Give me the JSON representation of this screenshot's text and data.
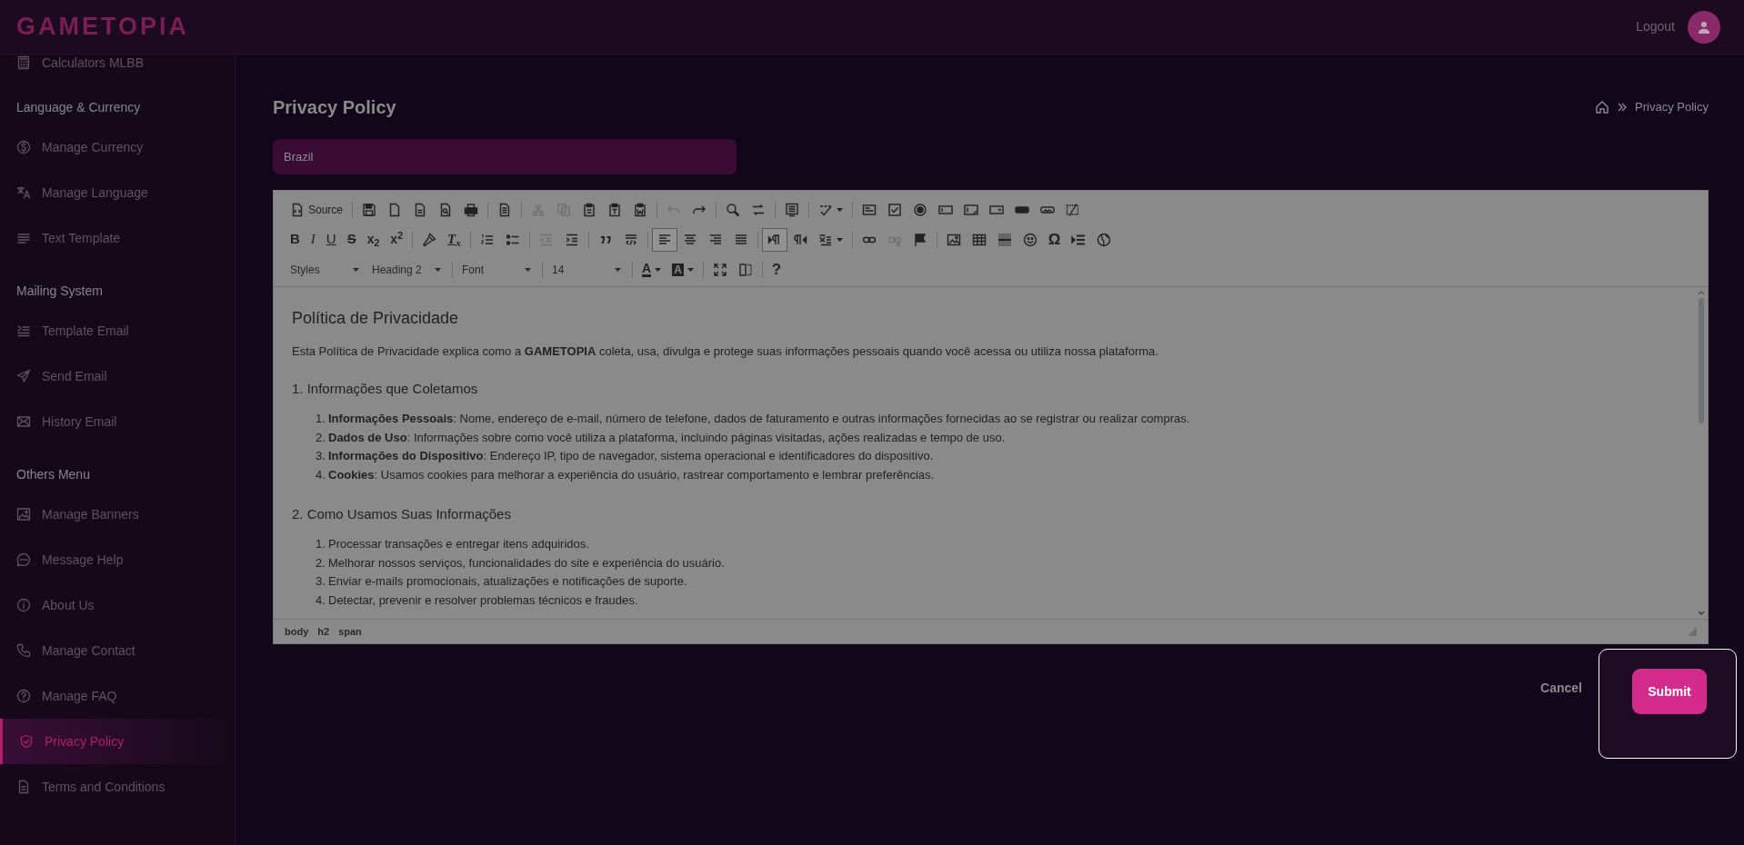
{
  "header": {
    "logo": "GAMETOPIA",
    "logout": "Logout"
  },
  "sidebar": {
    "top_item": {
      "label": "Calculators MLBB",
      "selected": false
    },
    "sections": [
      {
        "title": "Language & Currency",
        "items": [
          {
            "label": "Manage Currency",
            "selected": false
          },
          {
            "label": "Manage Language",
            "selected": false
          },
          {
            "label": "Text Template",
            "selected": false
          }
        ]
      },
      {
        "title": "Mailing System",
        "items": [
          {
            "label": "Template Email",
            "selected": false
          },
          {
            "label": "Send Email",
            "selected": false
          },
          {
            "label": "History Email",
            "selected": false
          }
        ]
      },
      {
        "title": "Others Menu",
        "items": [
          {
            "label": "Manage Banners",
            "selected": false
          },
          {
            "label": "Message Help",
            "selected": false
          },
          {
            "label": "About Us",
            "selected": false
          },
          {
            "label": "Manage Contact",
            "selected": false
          },
          {
            "label": "Manage FAQ",
            "selected": false
          },
          {
            "label": "Privacy Policy",
            "selected": true
          },
          {
            "label": "Terms and Conditions",
            "selected": false
          }
        ]
      }
    ]
  },
  "page": {
    "title": "Privacy Policy",
    "breadcrumb": "Privacy Policy",
    "country": "Brazil"
  },
  "toolbar": {
    "rows": [
      [
        [
          {
            "kind": "button",
            "label": "Source",
            "disabled": false,
            "on": false
          }
        ],
        [
          {
            "kind": "button",
            "disabled": false,
            "on": false
          },
          {
            "kind": "button",
            "disabled": false,
            "on": false
          },
          {
            "kind": "button",
            "disabled": false,
            "on": false
          },
          {
            "kind": "button",
            "disabled": false,
            "on": false
          },
          {
            "kind": "button",
            "disabled": false,
            "on": false
          }
        ],
        [
          {
            "kind": "button",
            "disabled": false,
            "on": false
          }
        ],
        [
          {
            "kind": "button",
            "disabled": true,
            "on": false
          },
          {
            "kind": "button",
            "disabled": true,
            "on": false
          },
          {
            "kind": "button",
            "disabled": false,
            "on": false
          },
          {
            "kind": "button",
            "disabled": false,
            "on": false
          },
          {
            "kind": "button",
            "disabled": false,
            "on": false
          }
        ],
        [
          {
            "kind": "button",
            "disabled": true,
            "on": false
          },
          {
            "kind": "button",
            "disabled": false,
            "on": false
          }
        ],
        [
          {
            "kind": "button",
            "disabled": false,
            "on": false
          },
          {
            "kind": "button",
            "disabled": false,
            "on": false
          }
        ],
        [
          {
            "kind": "button",
            "disabled": false,
            "on": false
          }
        ],
        [
          {
            "kind": "split",
            "disabled": false,
            "on": false
          }
        ],
        [
          {
            "kind": "button",
            "disabled": false,
            "on": false
          },
          {
            "kind": "button",
            "disabled": false,
            "on": false
          },
          {
            "kind": "button",
            "disabled": false,
            "on": false
          },
          {
            "kind": "button",
            "disabled": false,
            "on": false
          },
          {
            "kind": "button",
            "disabled": false,
            "on": false
          },
          {
            "kind": "button",
            "disabled": false,
            "on": false
          },
          {
            "kind": "button",
            "disabled": false,
            "on": false
          },
          {
            "kind": "button",
            "disabled": false,
            "on": false
          },
          {
            "kind": "button",
            "disabled": false,
            "on": false
          }
        ]
      ],
      [
        [
          {
            "kind": "button",
            "label": "B",
            "disabled": false,
            "on": false
          },
          {
            "kind": "button",
            "label": "I",
            "disabled": false,
            "on": false
          },
          {
            "kind": "button",
            "label": "U",
            "disabled": false,
            "on": false
          },
          {
            "kind": "button",
            "label": "S",
            "disabled": false,
            "on": false
          },
          {
            "kind": "button",
            "label": "x$_{2}$",
            "disabled": false,
            "on": false
          },
          {
            "kind": "button",
            "label": "x$^{2}$",
            "disabled": false,
            "on": false
          }
        ],
        [
          {
            "kind": "button",
            "disabled": false,
            "on": false
          },
          {
            "kind": "button",
            "label": "T$_{x}$",
            "disabled": false,
            "on": false
          }
        ],
        [
          {
            "kind": "button",
            "disabled": false,
            "on": false
          },
          {
            "kind": "button",
            "disabled": false,
            "on": false
          }
        ],
        [
          {
            "kind": "button",
            "disabled": true,
            "on": false
          },
          {
            "kind": "button",
            "disabled": false,
            "on": false
          }
        ],
        [
          {
            "kind": "button",
            "disabled": false,
            "on": false
          },
          {
            "kind": "button",
            "disabled": false,
            "on": false
          }
        ],
        [
          {
            "kind": "button",
            "disabled": false,
            "on": true
          },
          {
            "kind": "button",
            "disabled": false,
            "on": false
          },
          {
            "kind": "button",
            "disabled": false,
            "on": false
          },
          {
            "kind": "button",
            "disabled": false,
            "on": false
          }
        ],
        [
          {
            "kind": "button",
            "disabled": false,
            "on": true
          },
          {
            "kind": "button",
            "disabled": false,
            "on": false
          },
          {
            "kind": "split",
            "disabled": false,
            "on": false
          }
        ],
        [
          {
            "kind": "button",
            "disabled": false,
            "on": false
          },
          {
            "kind": "button",
            "disabled": true,
            "on": false
          },
          {
            "kind": "button",
            "disabled": false,
            "on": false
          }
        ],
        [
          {
            "kind": "button",
            "disabled": false,
            "on": false
          },
          {
            "kind": "button",
            "disabled": false,
            "on": false
          },
          {
            "kind": "button",
            "disabled": false,
            "on": false
          },
          {
            "kind": "button",
            "disabled": false,
            "on": false
          },
          {
            "kind": "button",
            "label": "Ω",
            "disabled": false,
            "on": false
          },
          {
            "kind": "button",
            "disabled": false,
            "on": false
          },
          {
            "kind": "button",
            "disabled": false,
            "on": false
          }
        ]
      ],
      [
        [
          {
            "kind": "combo",
            "label": "Styles"
          },
          {
            "kind": "combo",
            "label": "Heading 2"
          }
        ],
        [
          {
            "kind": "combo",
            "label": "Font"
          }
        ],
        [
          {
            "kind": "combo",
            "label": "14"
          }
        ],
        [
          {
            "kind": "split",
            "label": "A",
            "disabled": false,
            "on": false
          },
          {
            "kind": "split",
            "label": "A",
            "disabled": false,
            "on": false
          }
        ],
        [
          {
            "kind": "button",
            "disabled": false,
            "on": false
          },
          {
            "kind": "button",
            "disabled": false,
            "on": false
          }
        ],
        [
          {
            "kind": "button",
            "label": "?",
            "disabled": false,
            "on": false
          }
        ]
      ]
    ]
  },
  "content": [
    {
      "kind": "h2",
      "text": "Política de Privacidade"
    },
    {
      "kind": "p",
      "text": "Esta Política de Privacidade explica como a **GAMETOPIA** coleta, usa, divulga e protege suas informações pessoais quando você acessa ou utiliza nossa plataforma."
    },
    {
      "kind": "h3",
      "text": "1. Informações que Coletamos"
    },
    {
      "kind": "ol",
      "items": [
        {
          "marker": "1.",
          "text": "**Informações Pessoais**: Nome, endereço de e-mail, número de telefone, dados de faturamento e outras informações fornecidas ao se registrar ou realizar compras."
        },
        {
          "marker": "2.",
          "text": "**Dados de Uso**: Informações sobre como você utiliza a plataforma, incluindo páginas visitadas, ações realizadas e tempo de uso."
        },
        {
          "marker": "3.",
          "text": "**Informações do Dispositivo**: Endereço IP, tipo de navegador, sistema operacional e identificadores do dispositivo."
        },
        {
          "marker": "4.",
          "text": "**Cookies**: Usamos cookies para melhorar a experiência do usuário, rastrear comportamento e lembrar preferências."
        }
      ]
    },
    {
      "kind": "h3",
      "text": "2. Como Usamos Suas Informações"
    },
    {
      "kind": "ol",
      "items": [
        {
          "marker": "1.",
          "text": "Processar transações e entregar itens adquiridos."
        },
        {
          "marker": "2.",
          "text": "Melhorar nossos serviços, funcionalidades do site e experiência do usuário."
        },
        {
          "marker": "3.",
          "text": "Enviar e-mails promocionais, atualizações e notificações de suporte."
        },
        {
          "marker": "4.",
          "text": "Detectar, prevenir e resolver problemas técnicos e fraudes."
        }
      ]
    }
  ],
  "status_path": [
    "body",
    "h2",
    "span"
  ],
  "actions": {
    "cancel": "Cancel",
    "submit": "Submit"
  }
}
